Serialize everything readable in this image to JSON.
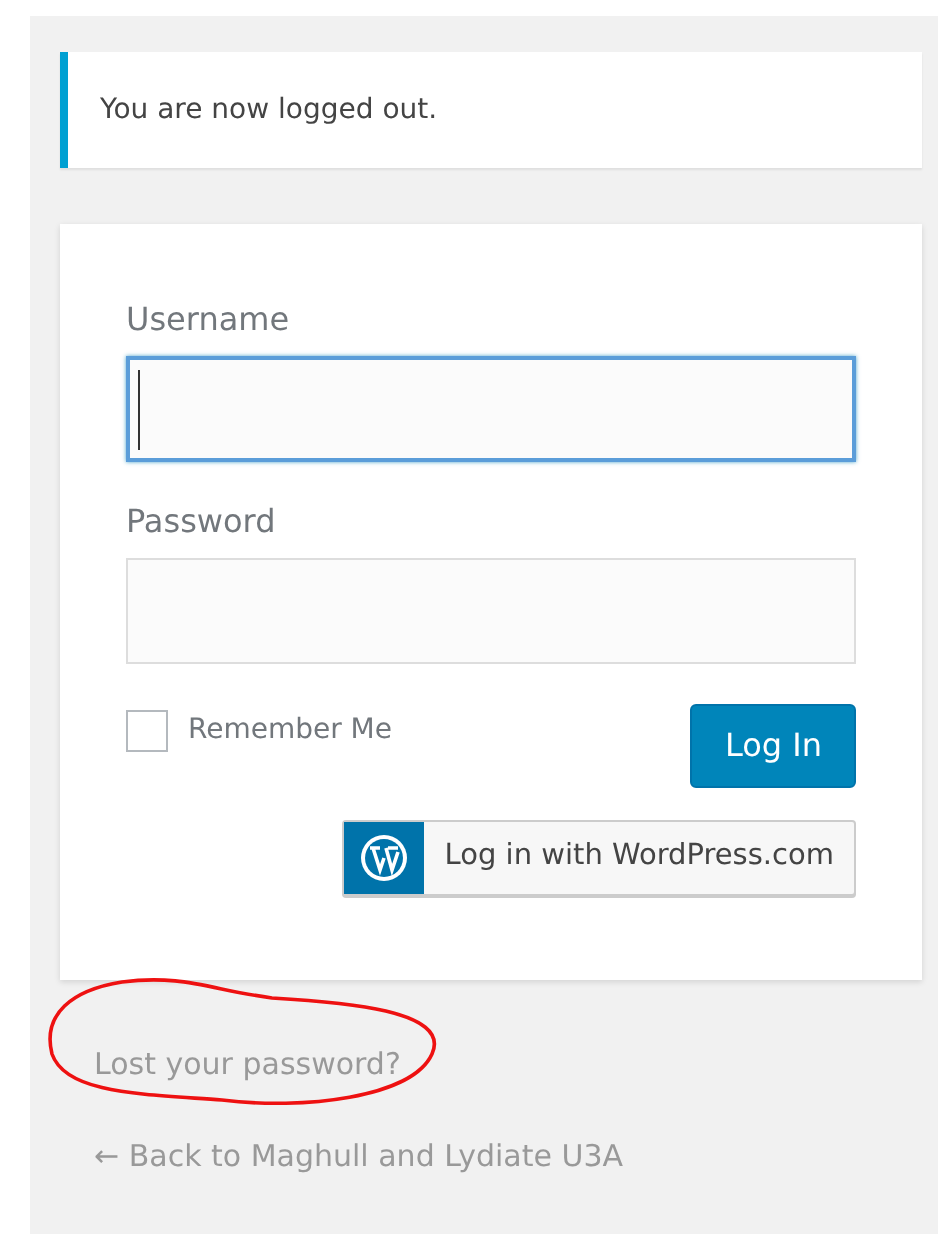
{
  "notice": {
    "message": "You are now logged out."
  },
  "form": {
    "fields": [
      {
        "label": "Username",
        "focused": true
      },
      {
        "label": "Password",
        "focused": false
      }
    ],
    "remember": {
      "label": "Remember Me",
      "checked": false
    },
    "submit": "Log In",
    "wordpress_login": "Log in with WordPress.com"
  },
  "links": [
    {
      "label": "Lost your password?",
      "circled": true
    },
    {
      "label": "← Back to Maghull and Lydiate U3A",
      "circled": false
    }
  ]
}
